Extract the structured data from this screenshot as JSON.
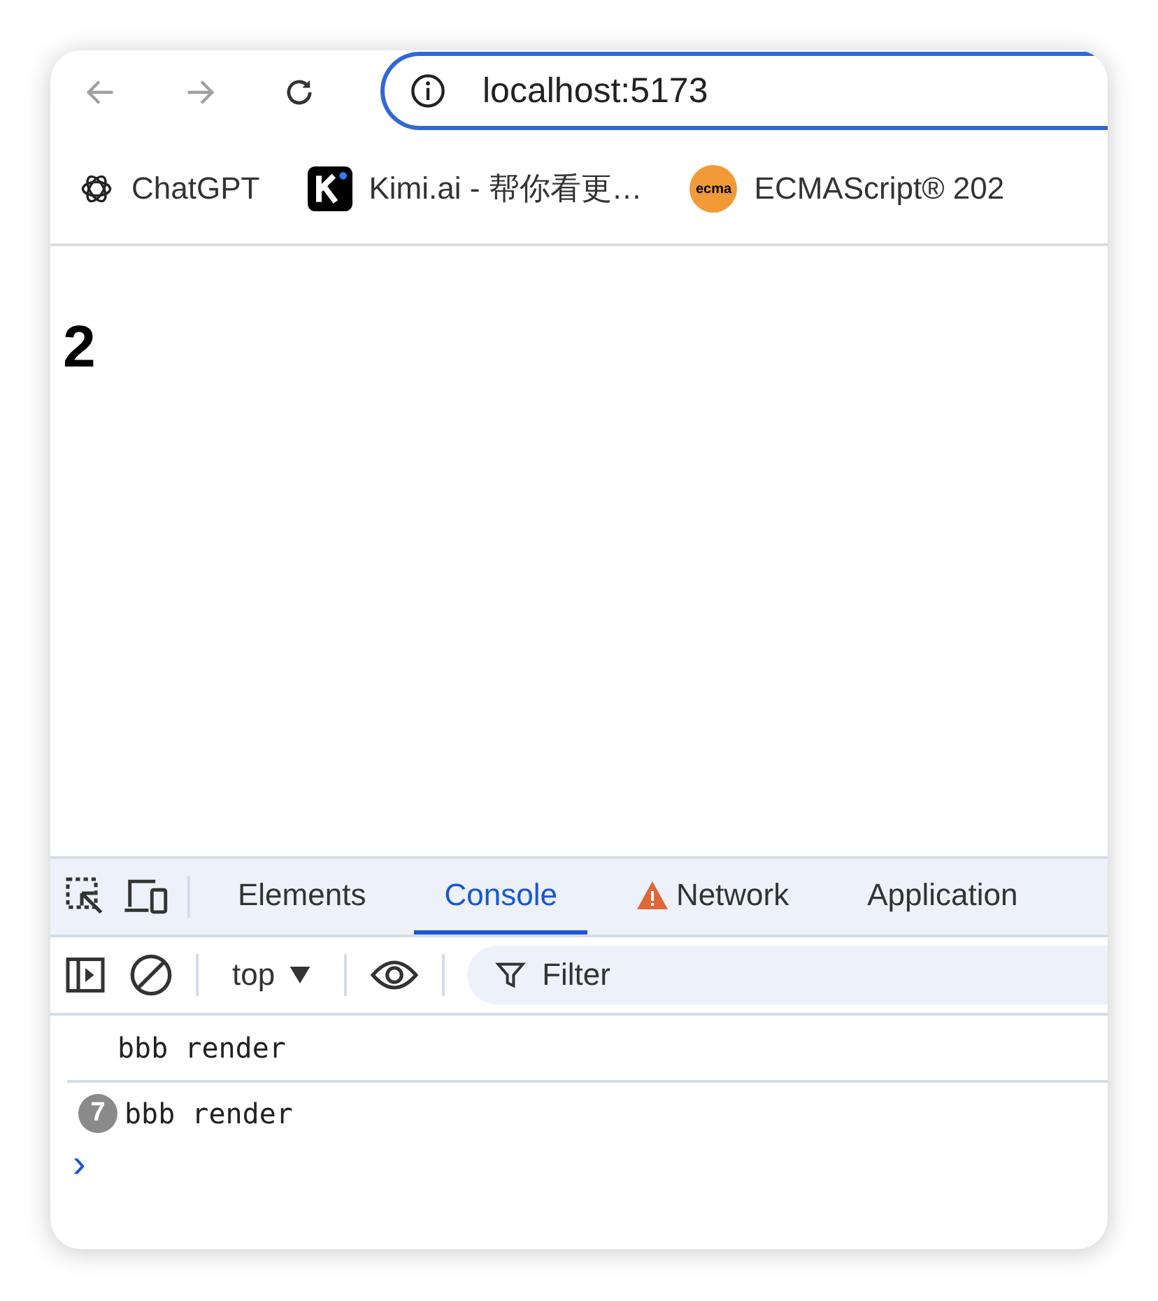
{
  "address_bar": {
    "url": "localhost:5173"
  },
  "bookmarks": [
    {
      "label": "ChatGPT",
      "kind": "chatgpt"
    },
    {
      "label": "Kimi.ai - 帮你看更…",
      "kind": "kimi"
    },
    {
      "label": "ECMAScript® 202",
      "kind": "ecma",
      "icon_text": "ecma"
    }
  ],
  "page": {
    "heading": "2"
  },
  "devtools": {
    "tabs": [
      {
        "label": "Elements",
        "selected": false,
        "warning": false
      },
      {
        "label": "Console",
        "selected": true,
        "warning": false
      },
      {
        "label": "Network",
        "selected": false,
        "warning": true
      },
      {
        "label": "Application",
        "selected": false,
        "warning": false
      }
    ],
    "context": "top",
    "filter_placeholder": "Filter",
    "messages": [
      {
        "text": "bbb render"
      },
      {
        "text": "bbb render",
        "count": "7"
      }
    ],
    "prompt": "›"
  }
}
